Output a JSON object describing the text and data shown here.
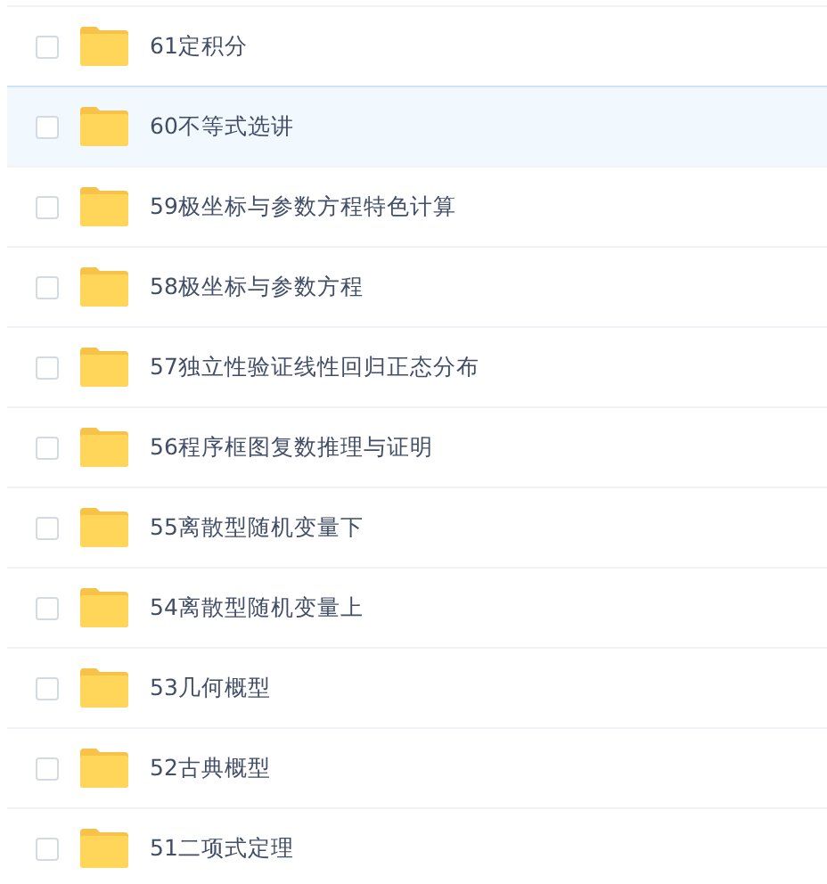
{
  "files": [
    {
      "name": "61定积分",
      "selected": false,
      "checked": false
    },
    {
      "name": "60不等式选讲",
      "selected": true,
      "checked": false
    },
    {
      "name": "59极坐标与参数方程特色计算",
      "selected": false,
      "checked": false
    },
    {
      "name": "58极坐标与参数方程",
      "selected": false,
      "checked": false
    },
    {
      "name": "57独立性验证线性回归正态分布",
      "selected": false,
      "checked": false
    },
    {
      "name": "56程序框图复数推理与证明",
      "selected": false,
      "checked": false
    },
    {
      "name": "55离散型随机变量下",
      "selected": false,
      "checked": false
    },
    {
      "name": "54离散型随机变量上",
      "selected": false,
      "checked": false
    },
    {
      "name": "53几何概型",
      "selected": false,
      "checked": false
    },
    {
      "name": "52古典概型",
      "selected": false,
      "checked": false
    },
    {
      "name": "51二项式定理",
      "selected": false,
      "checked": false
    }
  ]
}
